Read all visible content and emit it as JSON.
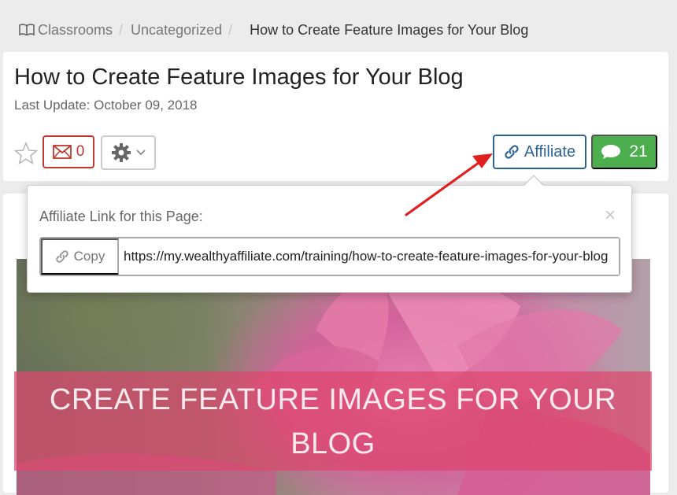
{
  "breadcrumb": {
    "items": [
      {
        "label": "Classrooms",
        "icon": "book-icon"
      },
      {
        "label": "Uncategorized"
      }
    ],
    "current": "How to Create Feature Images for Your Blog"
  },
  "page": {
    "title": "How to Create Feature Images for Your Blog",
    "last_update": "Last Update: October 09, 2018"
  },
  "toolbar": {
    "star_icon": "star-outline-icon",
    "mail_count": "0",
    "mail_icon": "envelope-icon",
    "settings_icon": "gear-icon",
    "affiliate_label": "Affiliate",
    "affiliate_icon": "link-icon",
    "comments_count": "21",
    "comments_icon": "speech-bubble-icon"
  },
  "popover": {
    "title": "Affiliate Link for this Page:",
    "close_symbol": "×",
    "copy_label": "Copy",
    "link_value": "https://my.wealthyaffiliate.com/training/how-to-create-feature-images-for-your-blog"
  },
  "feature_image": {
    "banner_text_line1": "CREATE FEATURE IMAGES FOR YOUR",
    "banner_text_line2": "BLOG"
  },
  "colors": {
    "affiliate_border": "#2a6496",
    "comments_bg": "#4cae4c",
    "mail_border": "#c0392b",
    "annotation_arrow": "#e02020"
  }
}
